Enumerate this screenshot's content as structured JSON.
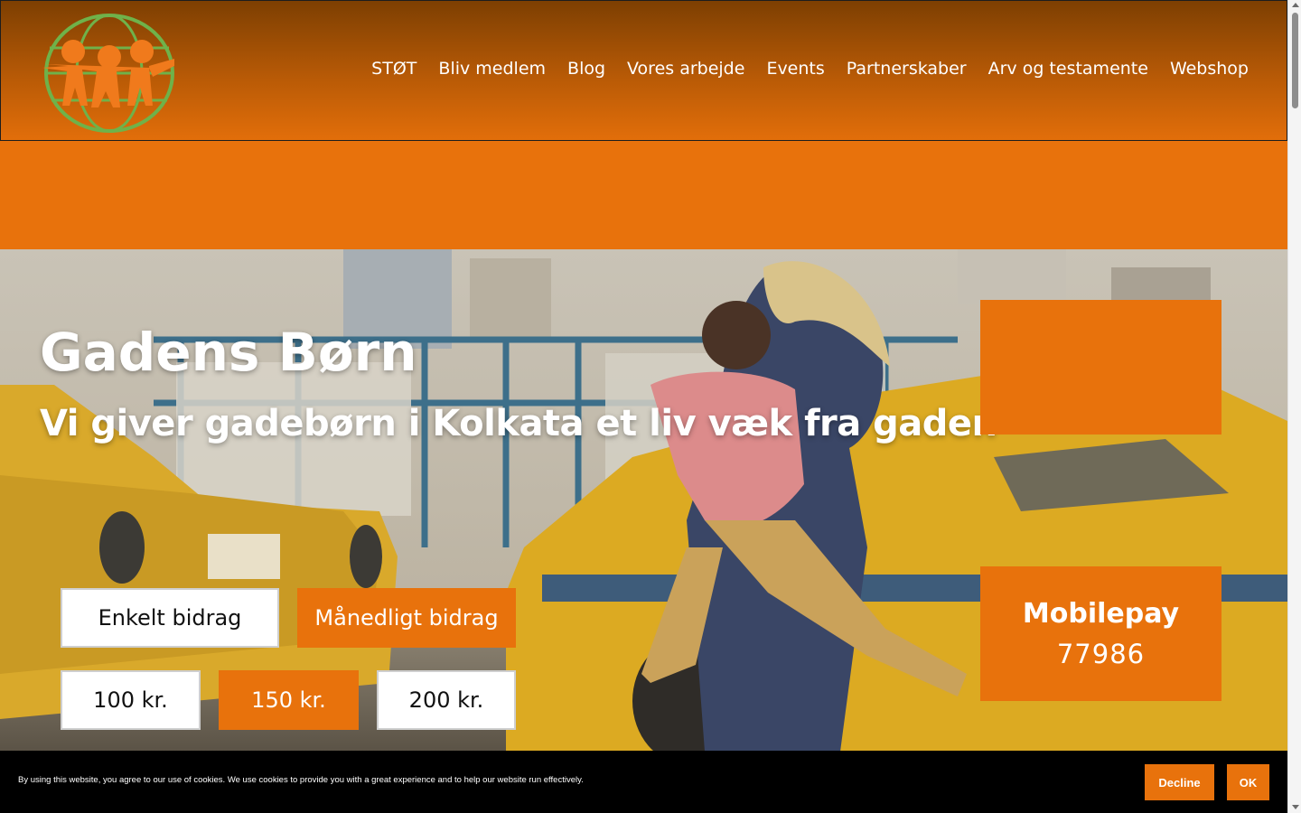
{
  "header": {
    "logo_icon": "children-globe-logo",
    "nav": [
      {
        "label": "STØT"
      },
      {
        "label": "Bliv medlem"
      },
      {
        "label": "Blog"
      },
      {
        "label": "Vores arbejde"
      },
      {
        "label": "Events"
      },
      {
        "label": "Partnerskaber"
      },
      {
        "label": "Arv og testamente"
      },
      {
        "label": "Webshop"
      }
    ]
  },
  "hero": {
    "title": "Gadens Børn",
    "subtitle": "Vi giver gadebørn i Kolkata et liv væk fra gaden",
    "background_icon": "kolkata-street-photo"
  },
  "donation": {
    "frequency_options": [
      "Enkelt bidrag",
      "Månedligt bidrag"
    ],
    "selected_frequency": "Månedligt bidrag",
    "amount_options": [
      "100 kr.",
      "150 kr.",
      "200 kr."
    ],
    "selected_amount": "150 kr."
  },
  "mobilepay": {
    "label": "Mobilepay",
    "number": "77986"
  },
  "cookie_bar": {
    "text": "By using this website, you agree to our use of cookies. We use cookies to provide you with a great experience and to help our website run effectively.",
    "decline_label": "Decline",
    "ok_label": "OK"
  },
  "colors": {
    "accent": "#e8720c",
    "header_top": "#7d3f02",
    "cookie_bg": "#000000"
  }
}
